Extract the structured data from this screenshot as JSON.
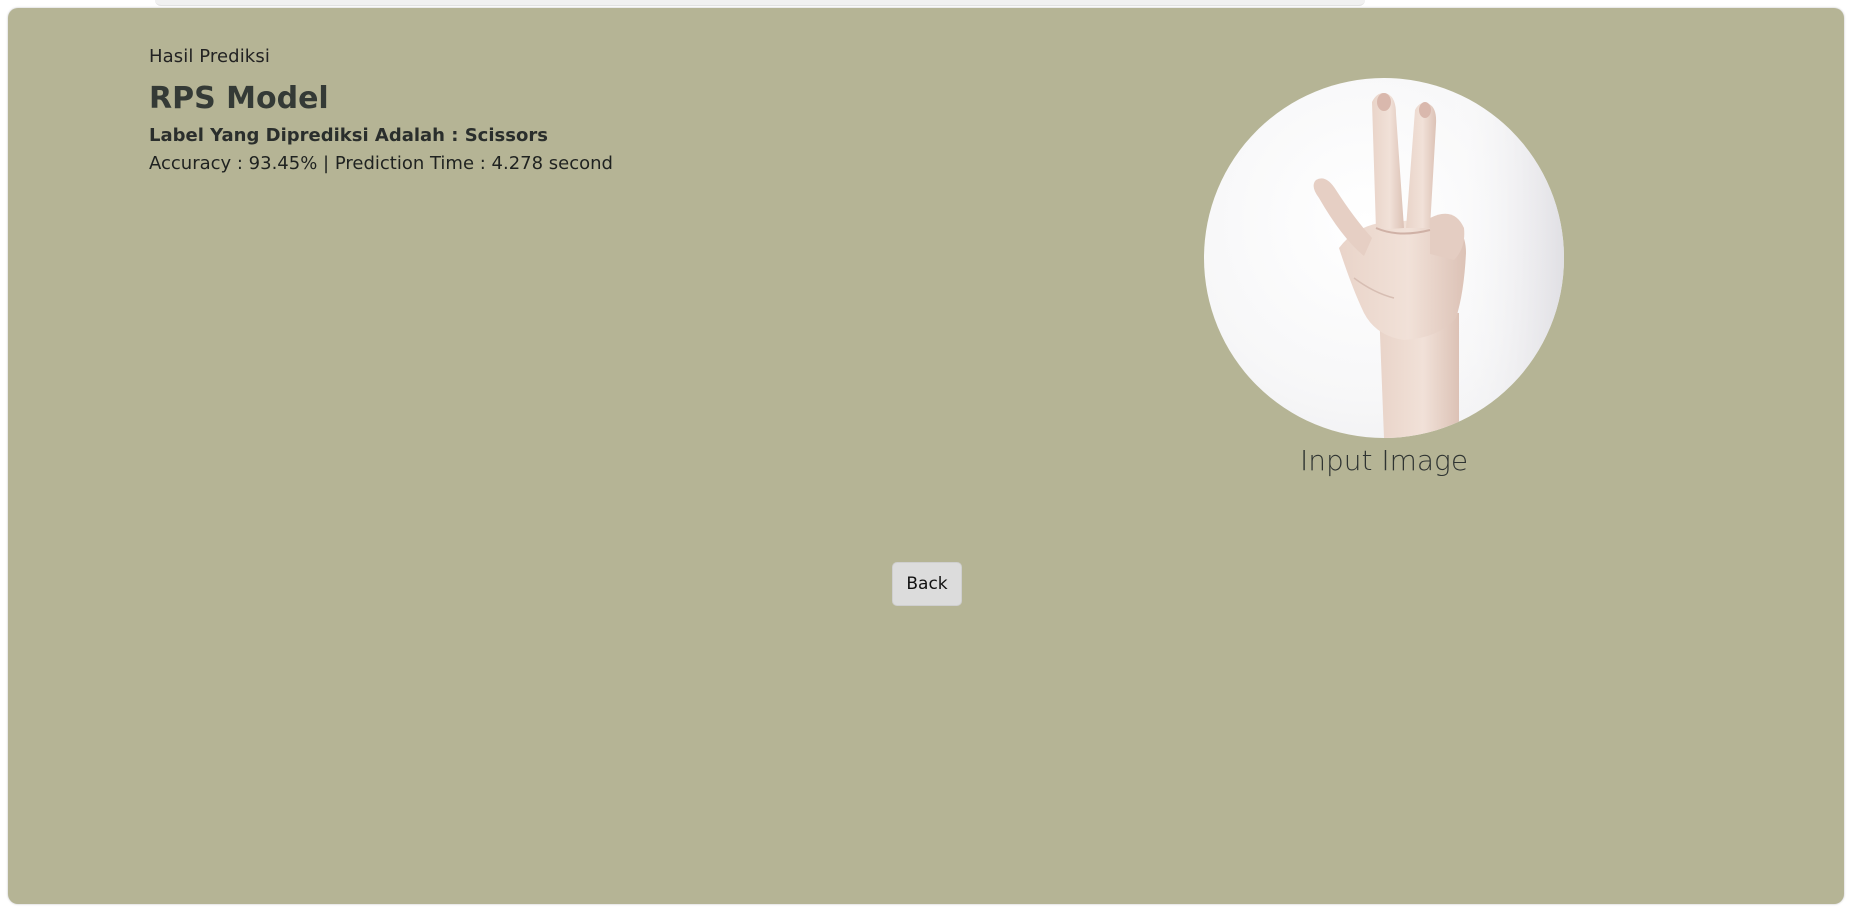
{
  "header": {
    "subtitle": "Hasil Prediksi",
    "title": "RPS Model"
  },
  "result": {
    "label_text": "Label Yang Diprediksi Adalah : Scissors",
    "metrics_text": "Accuracy : 93.45% | Prediction Time : 4.278 second"
  },
  "input_image": {
    "caption": "Input Image",
    "depicts": "hand-scissors-gesture"
  },
  "actions": {
    "back_label": "Back"
  },
  "colors": {
    "panel_background": "#b5b495",
    "button_background": "#dcdcdc"
  }
}
